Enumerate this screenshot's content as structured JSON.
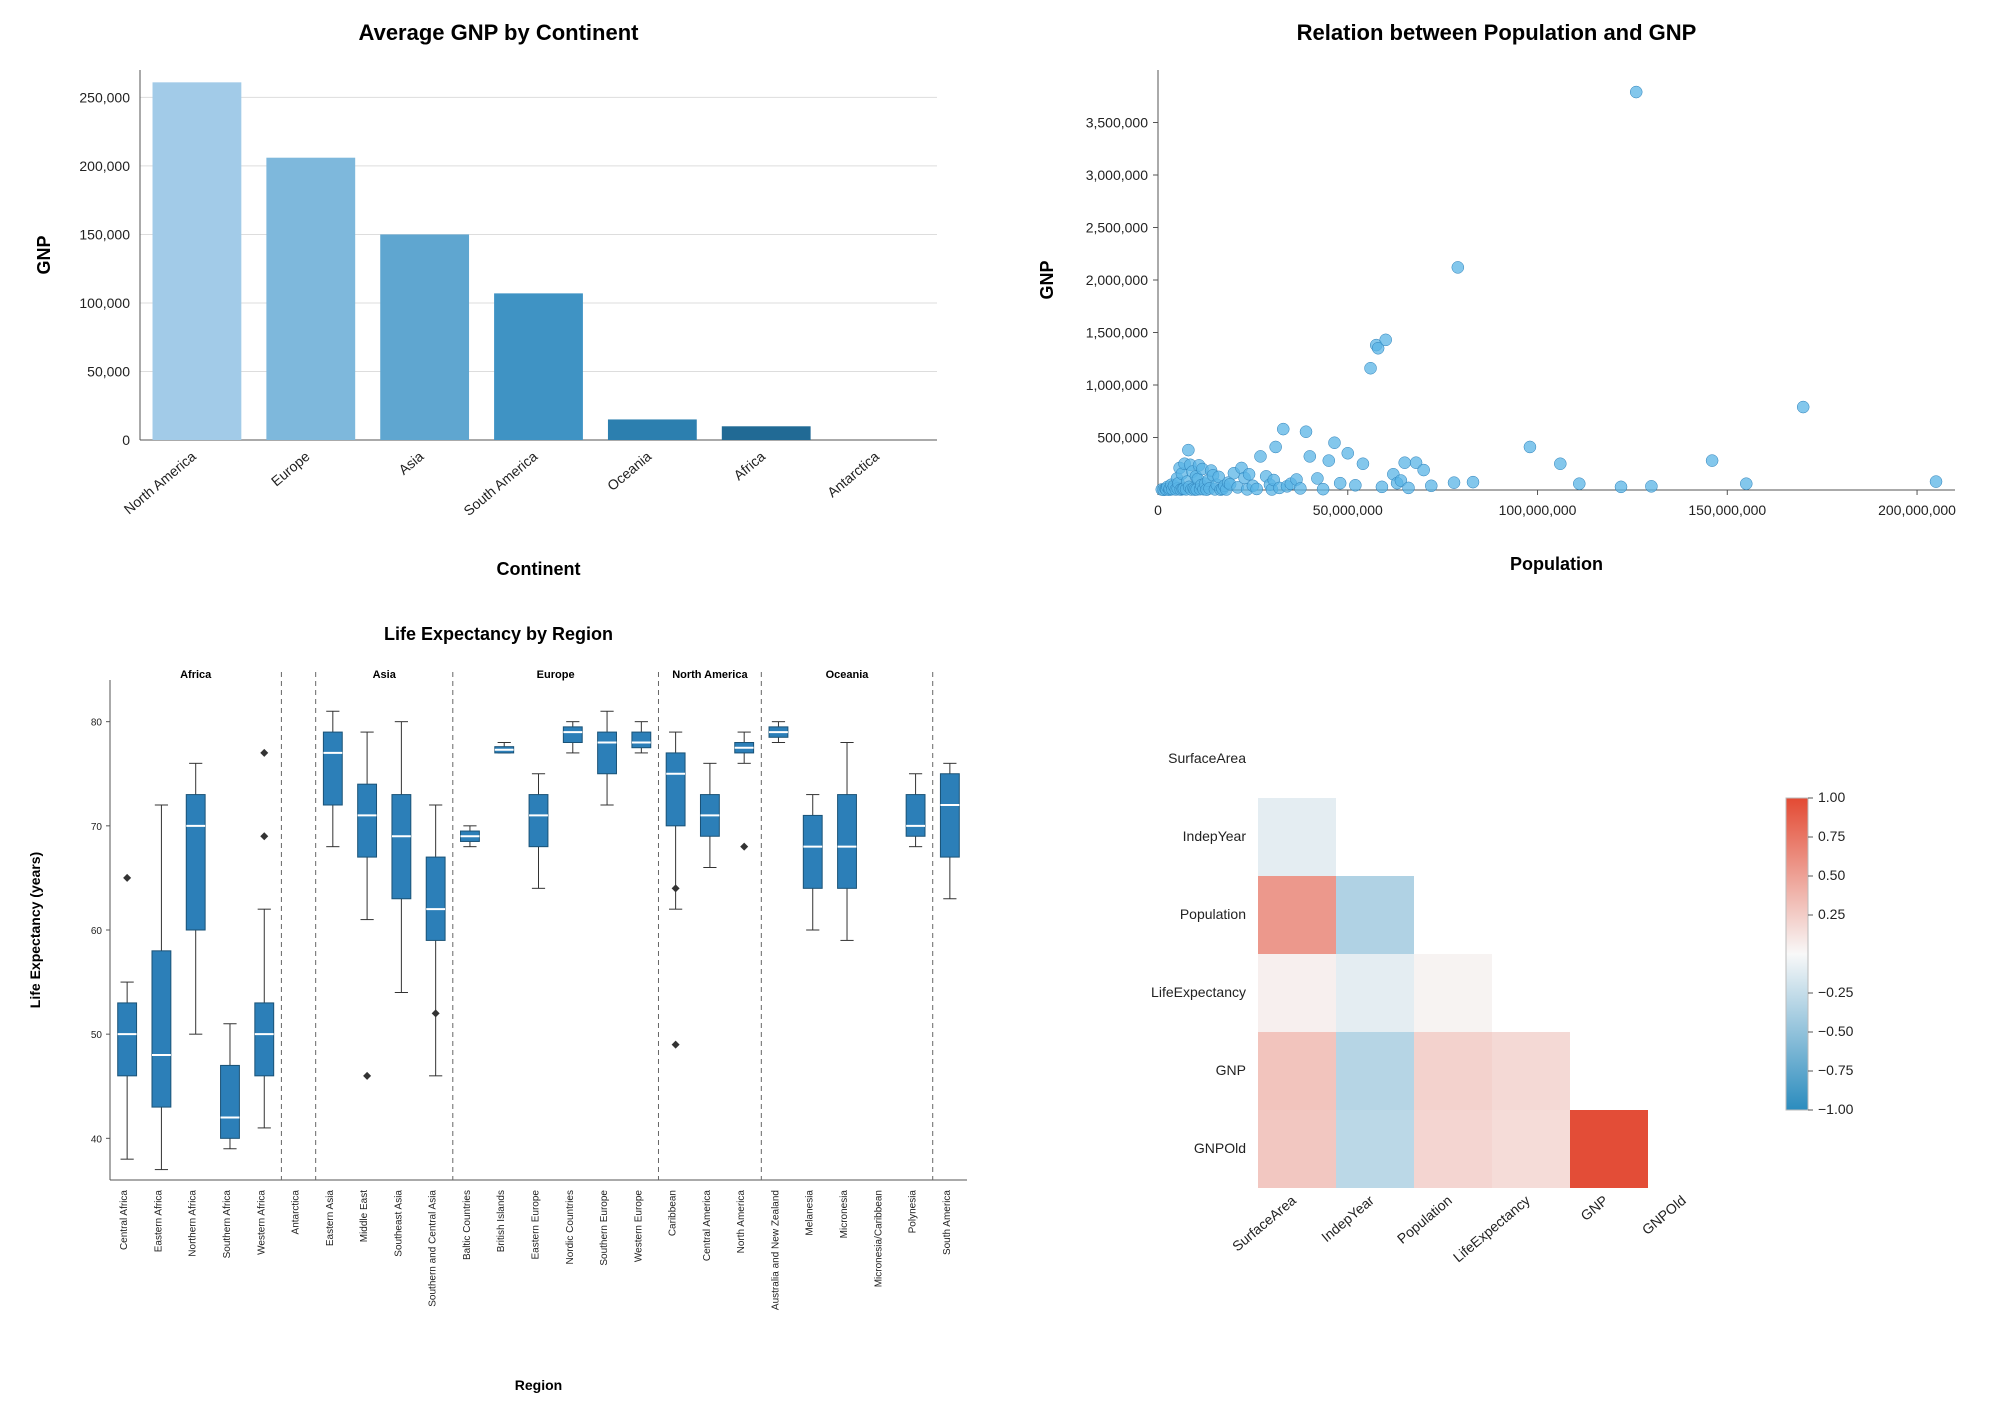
{
  "chart_data": [
    {
      "id": "bar",
      "type": "bar",
      "title": "Average GNP by Continent",
      "xlabel": "Continent",
      "ylabel": "GNP",
      "ylim": [
        0,
        270000
      ],
      "yticks": [
        0,
        50000,
        100000,
        150000,
        200000,
        250000
      ],
      "categories": [
        "North America",
        "Europe",
        "Asia",
        "South America",
        "Oceania",
        "Africa",
        "Antarctica"
      ],
      "values": [
        261000,
        206000,
        150000,
        107000,
        15000,
        10000,
        0
      ],
      "colors": [
        "#A2CBE8",
        "#7EB8DC",
        "#5FA6D0",
        "#3F93C4",
        "#2C7FAF",
        "#216A95",
        "#1A577C"
      ]
    },
    {
      "id": "scatter",
      "type": "scatter",
      "title": "Relation between Population and GNP",
      "xlabel": "Population",
      "ylabel": "GNP",
      "xlim": [
        0,
        210000000
      ],
      "ylim": [
        0,
        4000000
      ],
      "xticks": [
        0,
        50000000,
        100000000,
        150000000,
        200000000
      ],
      "yticks": [
        500000,
        1000000,
        1500000,
        2000000,
        2500000,
        3000000,
        3500000
      ],
      "points": [
        [
          1000000,
          5000
        ],
        [
          1500000,
          2000
        ],
        [
          2000000,
          10000
        ],
        [
          2200000,
          5000
        ],
        [
          2500000,
          30000
        ],
        [
          3000000,
          2000
        ],
        [
          3100000,
          15000
        ],
        [
          3500000,
          50000
        ],
        [
          3800000,
          8000
        ],
        [
          4200000,
          40000
        ],
        [
          4700000,
          5000
        ],
        [
          5000000,
          110000
        ],
        [
          5200000,
          15000
        ],
        [
          5400000,
          65000
        ],
        [
          5700000,
          210000
        ],
        [
          6000000,
          4000
        ],
        [
          6300000,
          155000
        ],
        [
          6500000,
          9000
        ],
        [
          6800000,
          12000
        ],
        [
          7000000,
          250000
        ],
        [
          7400000,
          6000
        ],
        [
          7700000,
          80000
        ],
        [
          8000000,
          380000
        ],
        [
          8200000,
          30000
        ],
        [
          8500000,
          240000
        ],
        [
          8800000,
          5000
        ],
        [
          9100000,
          175000
        ],
        [
          9400000,
          17000
        ],
        [
          9700000,
          4000
        ],
        [
          10000000,
          130000
        ],
        [
          10200000,
          5500
        ],
        [
          10500000,
          105000
        ],
        [
          10800000,
          235000
        ],
        [
          11100000,
          8000
        ],
        [
          11400000,
          45000
        ],
        [
          11700000,
          200000
        ],
        [
          12000000,
          7500
        ],
        [
          12400000,
          60000
        ],
        [
          12800000,
          3500
        ],
        [
          13200000,
          90000
        ],
        [
          13600000,
          15000
        ],
        [
          14000000,
          185000
        ],
        [
          14500000,
          140000
        ],
        [
          15000000,
          6000
        ],
        [
          15500000,
          50000
        ],
        [
          16000000,
          125000
        ],
        [
          16500000,
          3000
        ],
        [
          17000000,
          10000
        ],
        [
          17500000,
          40000
        ],
        [
          18000000,
          5000
        ],
        [
          18500000,
          70000
        ],
        [
          19000000,
          55000
        ],
        [
          20000000,
          160000
        ],
        [
          21000000,
          25000
        ],
        [
          22000000,
          210000
        ],
        [
          22800000,
          115000
        ],
        [
          23500000,
          6000
        ],
        [
          24000000,
          150000
        ],
        [
          25000000,
          40000
        ],
        [
          26000000,
          10000
        ],
        [
          27000000,
          320000
        ],
        [
          28500000,
          130000
        ],
        [
          29500000,
          50000
        ],
        [
          30000000,
          5000
        ],
        [
          30500000,
          95000
        ],
        [
          31000000,
          410000
        ],
        [
          32000000,
          20000
        ],
        [
          33000000,
          580000
        ],
        [
          34000000,
          35000
        ],
        [
          35000000,
          60000
        ],
        [
          36500000,
          100000
        ],
        [
          37500000,
          15000
        ],
        [
          39000000,
          555000
        ],
        [
          40000000,
          320000
        ],
        [
          42000000,
          110000
        ],
        [
          43500000,
          8000
        ],
        [
          45000000,
          280000
        ],
        [
          46500000,
          450000
        ],
        [
          48000000,
          65000
        ],
        [
          50000000,
          350000
        ],
        [
          52000000,
          45000
        ],
        [
          54000000,
          250000
        ],
        [
          56000000,
          1160000
        ],
        [
          57500000,
          1380000
        ],
        [
          58000000,
          1350000
        ],
        [
          59000000,
          30000
        ],
        [
          60000000,
          1430000
        ],
        [
          62000000,
          150000
        ],
        [
          63000000,
          65000
        ],
        [
          64000000,
          90000
        ],
        [
          65000000,
          260000
        ],
        [
          66000000,
          20000
        ],
        [
          68000000,
          260000
        ],
        [
          70000000,
          190000
        ],
        [
          72000000,
          40000
        ],
        [
          78000000,
          70000
        ],
        [
          79000000,
          2120000
        ],
        [
          83000000,
          75000
        ],
        [
          98000000,
          410000
        ],
        [
          106000000,
          250000
        ],
        [
          111000000,
          60000
        ],
        [
          122000000,
          30000
        ],
        [
          126000000,
          3790000
        ],
        [
          130000000,
          35000
        ],
        [
          146000000,
          280000
        ],
        [
          155000000,
          60000
        ],
        [
          170000000,
          790000
        ],
        [
          205000000,
          80000
        ]
      ],
      "point_color": "#5AB4E5"
    },
    {
      "id": "box",
      "type": "boxplot",
      "title": "Life Expectancy by Region",
      "xlabel": "Region",
      "ylabel": "Life Expectancy (years)",
      "ylim": [
        36,
        84
      ],
      "yticks": [
        40,
        50,
        60,
        70,
        80
      ],
      "facets": [
        {
          "name": "Africa",
          "regions": [
            "Central Africa",
            "Eastern Africa",
            "Northern Africa",
            "Southern Africa",
            "Western Africa"
          ]
        },
        {
          "name": "",
          "regions": [
            "Antarctica"
          ]
        },
        {
          "name": "Asia",
          "regions": [
            "Eastern Asia",
            "Middle East",
            "Southeast Asia",
            "Southern and Central Asia"
          ]
        },
        {
          "name": "Europe",
          "regions": [
            "Baltic Countries",
            "British Islands",
            "Eastern Europe",
            "Nordic Countries",
            "Southern Europe",
            "Western Europe"
          ]
        },
        {
          "name": "North America",
          "regions": [
            "Caribbean",
            "Central America",
            "North America"
          ]
        },
        {
          "name": "Oceania",
          "regions": [
            "Australia and New Zealand",
            "Melanesia",
            "Micronesia",
            "Micronesia/Caribbean",
            "Polynesia"
          ]
        },
        {
          "name": "",
          "regions": [
            "South America"
          ]
        }
      ],
      "boxes": {
        "Central Africa": {
          "min": 38,
          "q1": 46,
          "med": 50,
          "q3": 53,
          "max": 55,
          "out": [
            65
          ]
        },
        "Eastern Africa": {
          "min": 37,
          "q1": 43,
          "med": 48,
          "q3": 58,
          "max": 72,
          "out": []
        },
        "Northern Africa": {
          "min": 50,
          "q1": 60,
          "med": 70,
          "q3": 73,
          "max": 76,
          "out": []
        },
        "Southern Africa": {
          "min": 39,
          "q1": 40,
          "med": 42,
          "q3": 47,
          "max": 51,
          "out": []
        },
        "Western Africa": {
          "min": 41,
          "q1": 46,
          "med": 50,
          "q3": 53,
          "max": 62,
          "out": [
            77,
            69
          ]
        },
        "Antarctica": {
          "empty": true
        },
        "Eastern Asia": {
          "min": 68,
          "q1": 72,
          "med": 77,
          "q3": 79,
          "max": 81,
          "out": []
        },
        "Middle East": {
          "min": 61,
          "q1": 67,
          "med": 71,
          "q3": 74,
          "max": 79,
          "out": [
            46
          ]
        },
        "Southeast Asia": {
          "min": 54,
          "q1": 63,
          "med": 69,
          "q3": 73,
          "max": 80,
          "out": []
        },
        "Southern and Central Asia": {
          "min": 46,
          "q1": 59,
          "med": 62,
          "q3": 67,
          "max": 72,
          "out": [
            52
          ]
        },
        "Baltic Countries": {
          "min": 68,
          "q1": 68.5,
          "med": 69,
          "q3": 69.5,
          "max": 70,
          "out": []
        },
        "British Islands": {
          "min": 77,
          "q1": 77,
          "med": 77.3,
          "q3": 77.6,
          "max": 78,
          "out": []
        },
        "Eastern Europe": {
          "min": 64,
          "q1": 68,
          "med": 71,
          "q3": 73,
          "max": 75,
          "out": []
        },
        "Nordic Countries": {
          "min": 77,
          "q1": 78,
          "med": 79,
          "q3": 79.5,
          "max": 80,
          "out": []
        },
        "Southern Europe": {
          "min": 72,
          "q1": 75,
          "med": 78,
          "q3": 79,
          "max": 81,
          "out": []
        },
        "Western Europe": {
          "min": 77,
          "q1": 77.5,
          "med": 78,
          "q3": 79,
          "max": 80,
          "out": []
        },
        "Caribbean": {
          "min": 62,
          "q1": 70,
          "med": 75,
          "q3": 77,
          "max": 79,
          "out": [
            49,
            64
          ]
        },
        "Central America": {
          "min": 66,
          "q1": 69,
          "med": 71,
          "q3": 73,
          "max": 76,
          "out": []
        },
        "North America": {
          "min": 76,
          "q1": 77,
          "med": 77.5,
          "q3": 78,
          "max": 79,
          "out": [
            68
          ]
        },
        "Australia and New Zealand": {
          "min": 78,
          "q1": 78.5,
          "med": 79,
          "q3": 79.5,
          "max": 80,
          "out": []
        },
        "Melanesia": {
          "min": 60,
          "q1": 64,
          "med": 68,
          "q3": 71,
          "max": 73,
          "out": []
        },
        "Micronesia": {
          "min": 59,
          "q1": 64,
          "med": 68,
          "q3": 73,
          "max": 78,
          "out": []
        },
        "Micronesia/Caribbean": {
          "empty": true
        },
        "Polynesia": {
          "min": 68,
          "q1": 69,
          "med": 70,
          "q3": 73,
          "max": 75,
          "out": []
        },
        "South America": {
          "min": 63,
          "q1": 67,
          "med": 72,
          "q3": 75,
          "max": 76,
          "out": []
        }
      },
      "box_color": "#2C7FB8"
    },
    {
      "id": "heatmap",
      "type": "heatmap",
      "vars": [
        "SurfaceArea",
        "IndepYear",
        "Population",
        "LifeExpectancy",
        "GNP",
        "GNPOld"
      ],
      "legend_ticks": [
        1.0,
        0.75,
        0.5,
        0.25,
        -0.25,
        -0.5,
        -0.75,
        -1.0
      ],
      "color_pos": "#E34A33",
      "color_neg": "#2B8CBE",
      "matrix": [
        [
          null,
          null,
          null,
          null,
          null,
          null
        ],
        [
          -0.1,
          null,
          null,
          null,
          null,
          null
        ],
        [
          0.55,
          -0.35,
          null,
          null,
          null,
          null
        ],
        [
          0.05,
          -0.1,
          0.03,
          null,
          null,
          null
        ],
        [
          0.3,
          -0.32,
          0.22,
          0.18,
          null,
          null
        ],
        [
          0.28,
          -0.3,
          0.2,
          0.16,
          0.98,
          null
        ]
      ]
    }
  ]
}
